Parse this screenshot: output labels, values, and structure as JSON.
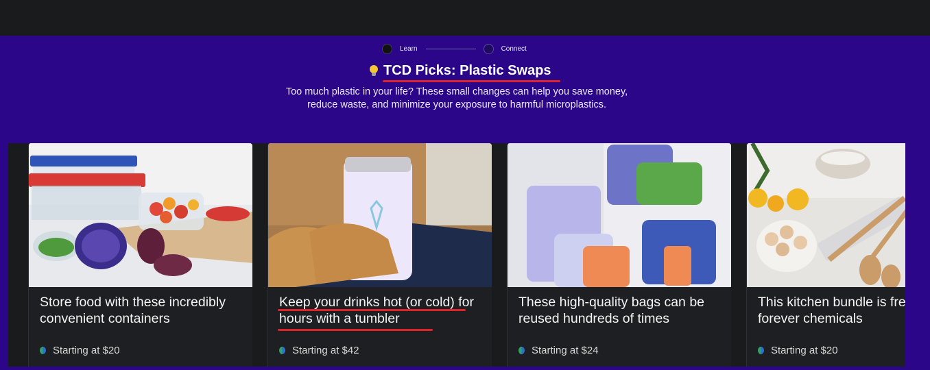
{
  "stepper": {
    "steps": [
      {
        "label": "Learn"
      },
      {
        "label": "Connect"
      }
    ]
  },
  "header": {
    "icon": "lightbulb-icon",
    "title": "TCD Picks: Plastic Swaps",
    "subtitle": "Too much plastic in your life? These small changes can help you save money, reduce waste, and minimize your exposure to harmful microplastics."
  },
  "colors": {
    "background": "#2b0689",
    "top_bar": "#1a1b1d",
    "card": "#1e1f22",
    "annotation": "#e0222b"
  },
  "cards": [
    {
      "title": "Store food with these incredibly convenient containers",
      "price": "Starting at $20",
      "image": "glass-food-containers-photo"
    },
    {
      "title": "Keep your drinks hot (or cold) for hours with a tumbler",
      "price": "Starting at $42",
      "image": "insulated-tumbler-photo"
    },
    {
      "title": "These high-quality bags can be reused hundreds of times",
      "price": "Starting at $24",
      "image": "silicone-bags-photo"
    },
    {
      "title": "This kitchen bundle is free of forever chemicals",
      "price": "Starting at $20",
      "image": "wooden-kitchen-utensils-photo"
    }
  ]
}
